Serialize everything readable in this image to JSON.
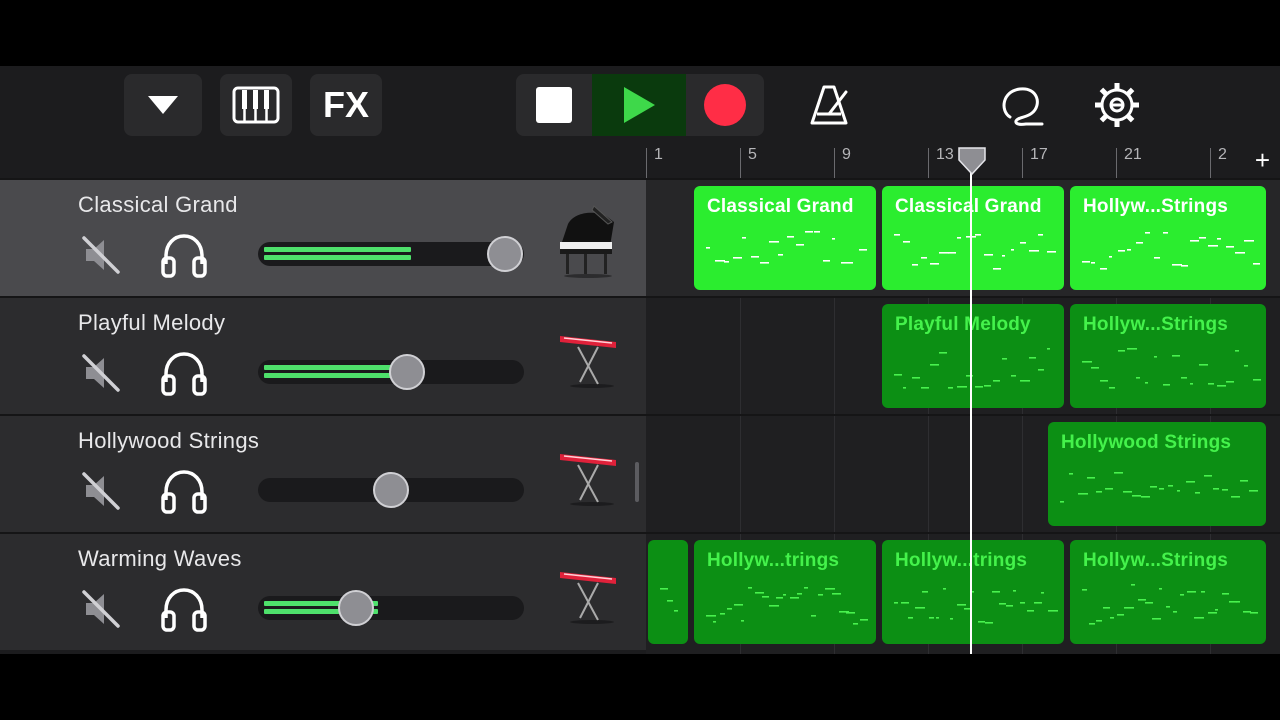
{
  "toolbar": {
    "buttons": [
      {
        "name": "browser-toggle",
        "icon": "triangle-down-icon"
      },
      {
        "name": "keyboard",
        "icon": "piano-keys-icon"
      },
      {
        "name": "fx",
        "label": "FX"
      },
      {
        "name": "stop",
        "icon": "stop-icon"
      },
      {
        "name": "play",
        "icon": "play-icon",
        "active": true
      },
      {
        "name": "record",
        "icon": "record-icon"
      },
      {
        "name": "metronome",
        "icon": "metronome-icon"
      },
      {
        "name": "loop-browser",
        "icon": "lasso-loop-icon"
      },
      {
        "name": "settings",
        "icon": "gear-icon"
      }
    ]
  },
  "ruler": {
    "ticks": [
      "1",
      "5",
      "9",
      "13",
      "17",
      "21",
      "2"
    ],
    "add_label": "+"
  },
  "tracks": [
    {
      "name": "Classical Grand",
      "instrument": "grand-piano-icon",
      "selected": true,
      "volume": 0.93,
      "meter": 0.58
    },
    {
      "name": "Playful Melody",
      "instrument": "keyboard-stand-icon",
      "selected": false,
      "volume": 0.56,
      "meter": 0.5
    },
    {
      "name": "Hollywood Strings",
      "instrument": "keyboard-stand-icon",
      "selected": false,
      "volume": 0.5,
      "meter": 0
    },
    {
      "name": "Warming Waves",
      "instrument": "keyboard-stand-icon",
      "selected": false,
      "volume": 0.37,
      "meter": 0.45
    }
  ],
  "regions": [
    [
      {
        "label": "Classical Grand",
        "style": "bright"
      },
      {
        "label": "Classical Grand",
        "style": "bright"
      },
      {
        "label": "Hollyw...Strings",
        "style": "bright"
      }
    ],
    [
      {
        "label": "Playful Melody",
        "style": "dark"
      },
      {
        "label": "Hollyw...Strings",
        "style": "dark"
      }
    ],
    [
      {
        "label": "Hollywood Strings",
        "style": "dark"
      }
    ],
    [
      {
        "label": "",
        "style": "dark"
      },
      {
        "label": "Hollyw...trings",
        "style": "dark"
      },
      {
        "label": "Hollyw...trings",
        "style": "dark"
      },
      {
        "label": "Hollyw...Strings",
        "style": "dark"
      }
    ]
  ],
  "colors": {
    "region_bright": "#2bed2f",
    "region_dark": "#0c8f14",
    "region_dark_text": "#44f24b",
    "meter": "#4ee06b",
    "record": "#ff2d46",
    "play": "#3ed84a"
  }
}
